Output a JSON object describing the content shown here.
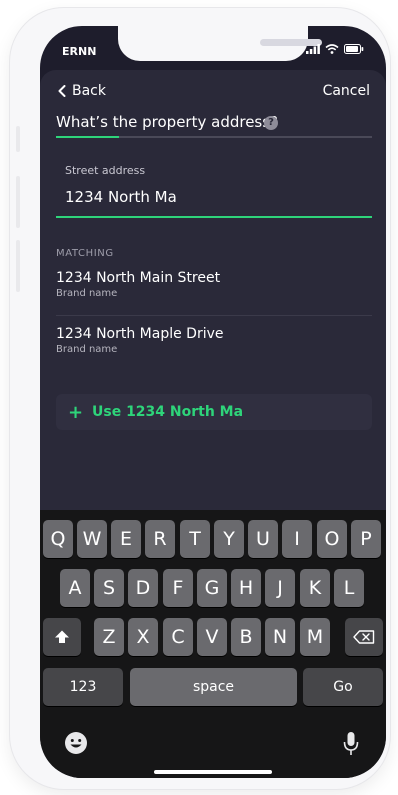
{
  "status_bar": {
    "carrier": "ERNN"
  },
  "nav": {
    "back_label": "Back",
    "cancel_label": "Cancel"
  },
  "question": {
    "text": "What’s the property address?",
    "help_icon": "?"
  },
  "progress": {
    "fraction": 0.2
  },
  "address_field": {
    "label": "Street address",
    "value": "1234 North Ma"
  },
  "matches": {
    "section_label": "MATCHING",
    "items": [
      {
        "title": "1234 North Main Street",
        "subtitle": "Brand name"
      },
      {
        "title": "1234 North Maple Drive",
        "subtitle": "Brand name"
      }
    ]
  },
  "use_option": {
    "label": "Use 1234 North Ma"
  },
  "keyboard": {
    "row1": [
      "Q",
      "W",
      "E",
      "R",
      "T",
      "Y",
      "U",
      "I",
      "O",
      "P"
    ],
    "row2": [
      "A",
      "S",
      "D",
      "F",
      "G",
      "H",
      "J",
      "K",
      "L"
    ],
    "row3": [
      "Z",
      "X",
      "C",
      "V",
      "B",
      "N",
      "M"
    ],
    "numbers_label": "123",
    "space_label": "space",
    "go_label": "Go"
  },
  "colors": {
    "accent": "#2ed47a",
    "background": "#1e1d2c",
    "sheet": "#2a2939"
  }
}
